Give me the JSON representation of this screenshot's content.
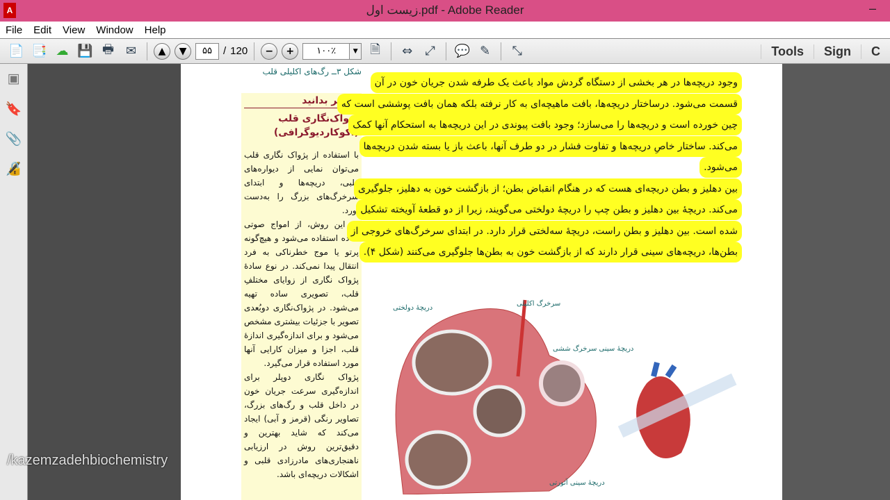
{
  "window": {
    "title": "زیست اول.pdf - Adobe Reader",
    "minimize": "–"
  },
  "menu": [
    "File",
    "Edit",
    "View",
    "Window",
    "Help"
  ],
  "toolbar": {
    "page_current": "۵۵",
    "page_sep": "/",
    "page_total": "120",
    "zoom": "۱۰۰٪",
    "right": [
      "Tools",
      "Sign",
      "C"
    ]
  },
  "page": {
    "caption": "شکل ۳ــ رگ‌های اکلیلی قلب",
    "box": {
      "heading": "بیشتر بدانید",
      "title1": "پژواک‌نگاری قلب",
      "title2": "(اکوکاردیوگرافی)",
      "p1": "با استفاده از پژواک نگاری قلب می‌توان نمایی از دیواره‌های قلبی، دریچه‌ها و ابتدای سرخرگ‌های بزرگ را به‌دست آورد.",
      "p2": "در این روش، از امواج صوتی ساده استفاده می‌شود و هیچ‌گونه پرتو یا موج خطرناکی به فرد انتقال پیدا نمی‌کند. در نوع سادهٔ پژواک نگاری از زوایای مختلفِ قلب، تصویری ساده تهیه می‌شود. در پژواک‌نگاری دوبُعدی تصویر با جزئیات بیشتری مشخص می‌شود و برای اندازه‌گیری اندازهٔ قلب، اجزا و میزان کارایی آنها مورد استفاده قرار می‌گیرد.",
      "p3": "پژواک نگاری دوپلر برای اندازه‌گیری سرعت جریان خون در داخل قلب و رگ‌های بزرگ، تصاویر رنگی (قرمز و آبی) ایجاد می‌کند که شاید بهترین و دقیق‌ترین روش در ارزیابی ناهنجاری‌های مادرزادی قلبی و اشکالات دریچه‌ای باشد."
    },
    "lines": [
      "وجود دریچه‌ها در هر بخشی از دستگاه گردش مواد باعث یک طرفه شدن جریان خون در آن",
      "قسمت می‌شود. درساختار دریچه‌ها، بافت ماهیچه‌ای به کار نرفته بلکه همان بافت پوششی است که",
      "چین خورده است و دریچه‌ها را می‌سازد؛ وجود بافت پیوندی در این دریچه‌ها به استحکام آنها کمک",
      "می‌کند. ساختار خاصِ دریچه‌ها و تفاوت فشار در دو طرف آنها، باعث باز یا بسته شدن دریچه‌ها",
      "می‌شود.",
      "بین دهلیز و بطن دریچه‌ای هست که در هنگام انقباض بطن؛ از بازگشت خون به دهلیز، جلوگیری",
      "می‌کند. دریچهٔ بین دهلیز و بطن چپ را دریچهٔ دولختی می‌گویند، زیرا از دو قطعهٔ آویخته تشکیل",
      "شده است. بین دهلیز و بطن راست، دریچهٔ سه‌لختی قرار دارد. در ابتدای سرخرگ‌های خروجی از",
      "بطن‌ها، دریچه‌های سینی قرار دارند که از بازگشت خون به بطن‌ها جلوگیری می‌کنند (شکل ۴)."
    ],
    "figure": {
      "mitral": "دریچهٔ دولختی",
      "coronary": "سرخرگ اکلیلی",
      "pulmonary": "دریچهٔ سینی سرخرگ ششی",
      "aortic": "دریچهٔ سینی آئورتی"
    }
  },
  "watermark": "/kazemzadehbiochemistry"
}
